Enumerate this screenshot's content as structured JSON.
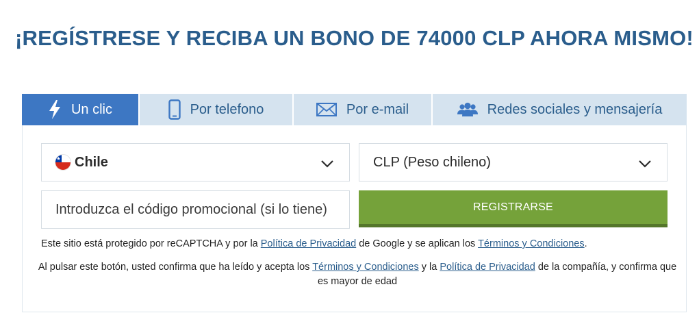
{
  "title": "¡REGÍSTRESE Y RECIBA UN BONO DE 74000 CLP AHORA MISMO!",
  "tabs": [
    {
      "label": "Un clic",
      "icon": "lightning-icon",
      "active": true
    },
    {
      "label": "Por telefono",
      "icon": "phone-icon",
      "active": false
    },
    {
      "label": "Por e-mail",
      "icon": "envelope-icon",
      "active": false
    },
    {
      "label": "Redes sociales y mensajería",
      "icon": "users-icon",
      "active": false
    }
  ],
  "form": {
    "country": {
      "value": "Chile",
      "flag": "chile-flag-icon"
    },
    "currency": {
      "value": "CLP (Peso chileno)"
    },
    "promo": {
      "placeholder": "Introduzca el código promocional (si lo tiene)"
    },
    "register_label": "REGISTRARSE"
  },
  "recaptcha_note": {
    "p1": "Este sitio está protegido por reCAPTCHA y por la ",
    "link1": "Política de Privacidad",
    "p2": " de Google y se aplican los ",
    "link2": "Términos y Condiciones",
    "p3": "."
  },
  "consent_note": {
    "p1": "Al pulsar este botón, usted confirma que ha leído y acepta los ",
    "link1": "Términos y Condiciones",
    "p2": " y la ",
    "link2": "Política de Privacidad",
    "p3": " de la compañía, y confirma que es mayor de edad"
  },
  "colors": {
    "title": "#2a5d8c",
    "tab_active_bg": "#3d77c3",
    "tab_bg": "#d5e3ef",
    "button": "#75a23a",
    "button_shadow": "#54762a"
  }
}
